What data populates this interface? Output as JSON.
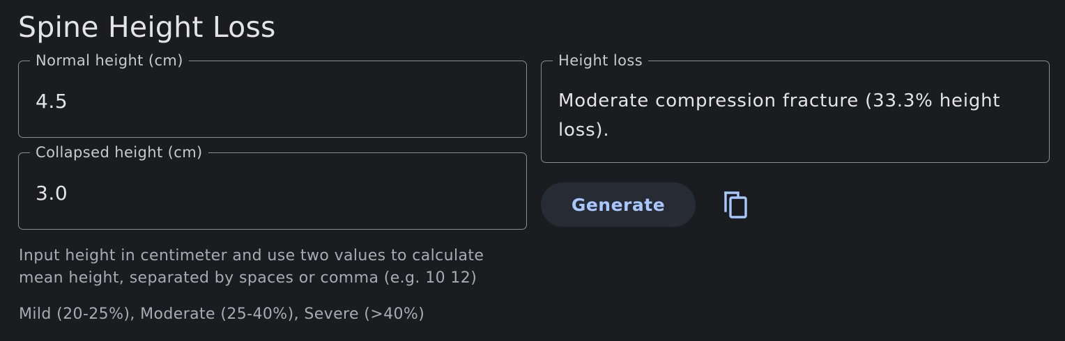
{
  "page": {
    "title": "Spine Height Loss"
  },
  "inputs": {
    "normal_height": {
      "label": "Normal height (cm)",
      "value": "4.5"
    },
    "collapsed_height": {
      "label": "Collapsed height (cm)",
      "value": "3.0"
    }
  },
  "result": {
    "label": "Height loss",
    "value": "Moderate compression fracture (33.3% height loss)."
  },
  "help": {
    "input_hint": "Input height in centimeter and use two values to calculate mean height, separated by spaces or comma (e.g. 10 12)",
    "severity_scale": "Mild (20-25%), Moderate (25-40%), Severe (>40%)"
  },
  "actions": {
    "generate_label": "Generate",
    "copy_icon": "copy-icon"
  },
  "colors": {
    "background": "#1b1c1f",
    "outline": "#8b8d94",
    "button_background": "#272b33",
    "accent": "#a9c7ff"
  }
}
